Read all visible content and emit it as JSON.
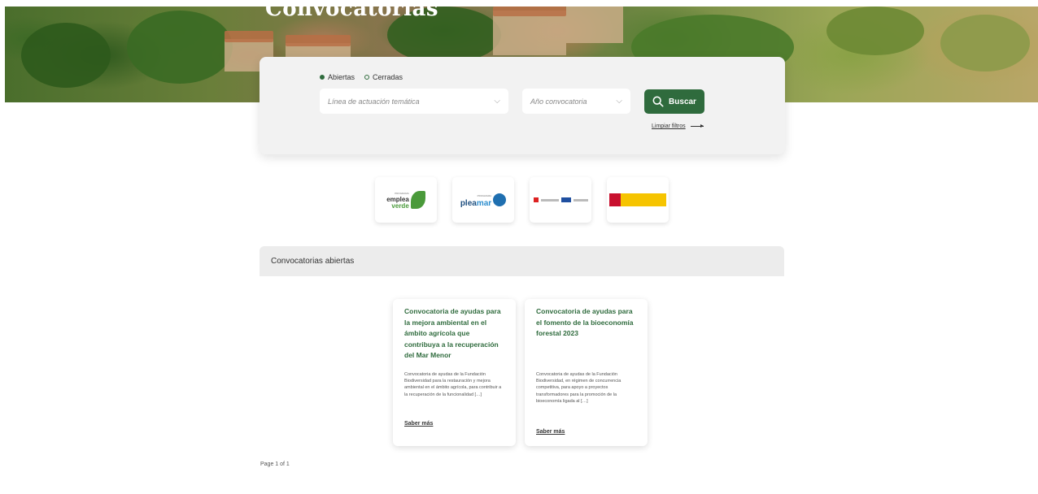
{
  "hero": {
    "title": "Convocatorias"
  },
  "search": {
    "radio_open": "Abiertas",
    "radio_closed": "Cerradas",
    "select_line_placeholder": "Línea de actuación temática",
    "select_year_placeholder": "Año convocatoria",
    "button_label": "Buscar",
    "clear_filters": "Limpiar filtros"
  },
  "logos": {
    "emplea": {
      "small": "PROGRAMA",
      "w1": "emplea",
      "w2": "verde"
    },
    "pleamar": {
      "small": "PROGRAMA",
      "w1": "plea",
      "w2": "mar"
    }
  },
  "section": {
    "title": "Convocatorias abiertas"
  },
  "cards": [
    {
      "title": "Convocatoria de ayudas para la mejora ambiental en el ámbito agrícola que contribuya a la recuperación del Mar Menor",
      "excerpt": "Convocatoria de ayudas de la Fundación Biodiversidad para la restauración y mejora ambiental en el ámbito agrícola, para contribuir a la recuperación de la funcionalidad […]",
      "link": "Saber más"
    },
    {
      "title": "Convocatoria de ayudas para el fomento de la bioeconomía forestal 2023",
      "excerpt": "Convocatoria de ayudas de la Fundación Biodiversidad, en régimen de concurrencia competitiva, para apoyo a proyectos transformadores para la promoción de la bioeconomía ligada al […]",
      "link": "Saber más"
    }
  ],
  "pager": {
    "text": "Page 1 of 1"
  },
  "colors": {
    "accent": "#2f6b3d",
    "panel": "#f2f2f2",
    "section": "#ececec"
  }
}
